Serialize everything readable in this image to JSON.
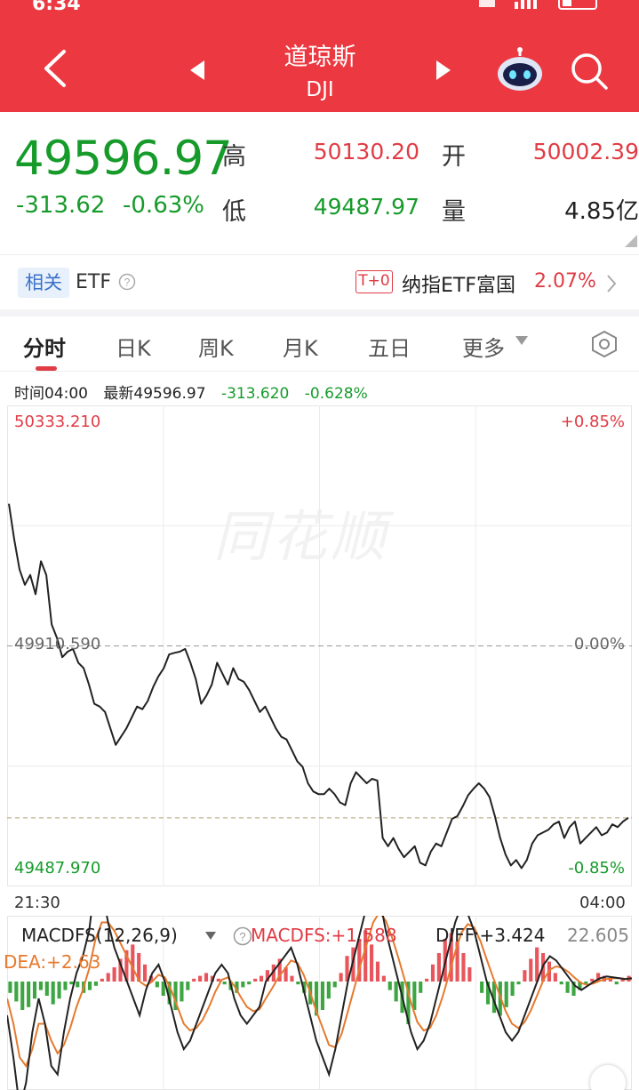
{
  "status": {
    "time": "6:34"
  },
  "header": {
    "title": "道琼斯",
    "subtitle": "DJI"
  },
  "quote": {
    "price": "49596.97",
    "change": "-313.62",
    "change_pct": "-0.63%",
    "high_label": "高",
    "high": "50130.20",
    "open_label": "开",
    "open": "50002.39",
    "low_label": "低",
    "low": "49487.97",
    "volume_label": "量",
    "volume": "4.85亿"
  },
  "etf": {
    "tag": "相关",
    "label": "ETF",
    "badge": "T+0",
    "name": "纳指ETF富国",
    "pct": "2.07%"
  },
  "tabs": [
    {
      "label": "分时"
    },
    {
      "label": "日K"
    },
    {
      "label": "周K"
    },
    {
      "label": "月K"
    },
    {
      "label": "五日"
    },
    {
      "label": "更多"
    }
  ],
  "info": {
    "time": "时间04:00",
    "latest": "最新49596.97",
    "change": "-313.620",
    "pct": "-0.628%"
  },
  "watermark": "同花顺",
  "colors": {
    "brand": "#ec3841",
    "up": "#e03c45",
    "down": "#169b2b",
    "dea": "#e67a2e"
  },
  "chart_data": {
    "type": "line",
    "ymax_label": "50333.210",
    "ymid_label": "49910.590",
    "ymin_label": "49487.970",
    "pmax_label": "+0.85%",
    "pmid_label": "0.00%",
    "pmin_label": "-0.85%",
    "xstart": "21:30",
    "xend": "04:00",
    "ylim": [
      49487.97,
      50333.21
    ],
    "prev_close": 49910.59,
    "last": 49596.97,
    "values": [
      50170,
      50105,
      50050,
      50022,
      50040,
      50005,
      50065,
      50040,
      49950,
      49925,
      49890,
      49900,
      49905,
      49880,
      49870,
      49840,
      49805,
      49800,
      49790,
      49760,
      49730,
      49745,
      49760,
      49780,
      49800,
      49795,
      49810,
      49835,
      49855,
      49870,
      49895,
      49898,
      49900,
      49905,
      49880,
      49850,
      49805,
      49820,
      49840,
      49880,
      49860,
      49840,
      49870,
      49850,
      49845,
      49830,
      49810,
      49790,
      49800,
      49780,
      49760,
      49745,
      49740,
      49720,
      49700,
      49690,
      49660,
      49645,
      49640,
      49640,
      49650,
      49640,
      49625,
      49620,
      49660,
      49680,
      49670,
      49660,
      49668,
      49665,
      49560,
      49545,
      49560,
      49540,
      49525,
      49535,
      49545,
      49515,
      49510,
      49535,
      49550,
      49545,
      49570,
      49595,
      49600,
      49618,
      49638,
      49650,
      49660,
      49650,
      49635,
      49600,
      49560,
      49530,
      49510,
      49520,
      49505,
      49520,
      49550,
      49565,
      49570,
      49575,
      49585,
      49590,
      49560,
      49580,
      49590,
      49550,
      49560,
      49570,
      49580,
      49565,
      49570,
      49585,
      49580,
      49590,
      49596.97
    ],
    "macd": {
      "label": "MACDFS(12,26,9)",
      "macdfs": "MACDFS:+1.588",
      "diff": "DIFF:+3.424",
      "dea": "DEA:+2.63",
      "right": "22.605",
      "hist": [
        -8,
        -14,
        -20,
        -18,
        -12,
        -6,
        -10,
        -16,
        -12,
        -6,
        -2,
        -4,
        -8,
        -6,
        -3,
        2,
        6,
        10,
        16,
        22,
        26,
        20,
        12,
        4,
        -4,
        -10,
        -16,
        -20,
        -14,
        -6,
        2,
        4,
        6,
        4,
        2,
        -2,
        -6,
        -8,
        -4,
        -2,
        2,
        4,
        8,
        12,
        16,
        10,
        4,
        -2,
        -8,
        -16,
        -24,
        -20,
        -12,
        -4,
        6,
        18,
        24,
        30,
        36,
        26,
        14,
        4,
        -6,
        -14,
        -22,
        -30,
        -20,
        -8,
        2,
        12,
        20,
        30,
        34,
        28,
        20,
        10,
        0,
        -8,
        -16,
        -22,
        -24,
        -18,
        -10,
        -2,
        8,
        16,
        24,
        20,
        14,
        6,
        -2,
        -8,
        -10,
        -6,
        -2,
        2,
        6,
        4,
        2,
        -2,
        2,
        4
      ],
      "diff_line": [
        -40,
        -90,
        -150,
        -120,
        -60,
        -20,
        -50,
        -100,
        -110,
        -60,
        -20,
        10,
        30,
        60,
        120,
        110,
        70,
        40,
        20,
        0,
        -20,
        -40,
        -10,
        10,
        20,
        0,
        -30,
        -60,
        -80,
        -70,
        -50,
        -30,
        -10,
        10,
        20,
        10,
        -20,
        -40,
        -50,
        -40,
        -30,
        0,
        10,
        20,
        30,
        40,
        20,
        -10,
        -40,
        -70,
        -90,
        -110,
        -80,
        -40,
        0,
        30,
        60,
        90,
        110,
        100,
        60,
        30,
        0,
        -30,
        -60,
        -80,
        -70,
        -50,
        -20,
        10,
        40,
        70,
        90,
        80,
        60,
        30,
        0,
        -20,
        -40,
        -60,
        -70,
        -60,
        -40,
        -20,
        0,
        20,
        30,
        25,
        15,
        5,
        -5,
        -10,
        -5,
        0,
        4,
        6,
        5,
        4,
        3,
        4
      ],
      "dea_line": [
        -20,
        -50,
        -90,
        -100,
        -80,
        -50,
        -50,
        -70,
        -85,
        -75,
        -55,
        -30,
        -10,
        15,
        50,
        70,
        70,
        60,
        45,
        30,
        15,
        0,
        -5,
        0,
        8,
        5,
        -10,
        -30,
        -50,
        -58,
        -55,
        -45,
        -30,
        -12,
        2,
        5,
        -5,
        -18,
        -30,
        -35,
        -33,
        -20,
        -8,
        5,
        15,
        25,
        22,
        8,
        -12,
        -35,
        -55,
        -75,
        -78,
        -62,
        -35,
        -8,
        20,
        45,
        70,
        82,
        72,
        52,
        28,
        2,
        -25,
        -48,
        -58,
        -55,
        -40,
        -18,
        8,
        35,
        58,
        68,
        64,
        48,
        26,
        5,
        -15,
        -35,
        -50,
        -55,
        -48,
        -34,
        -16,
        2,
        14,
        18,
        16,
        11,
        4,
        -2,
        -4,
        -2,
        1,
        3,
        4,
        4,
        3,
        3
      ]
    }
  }
}
